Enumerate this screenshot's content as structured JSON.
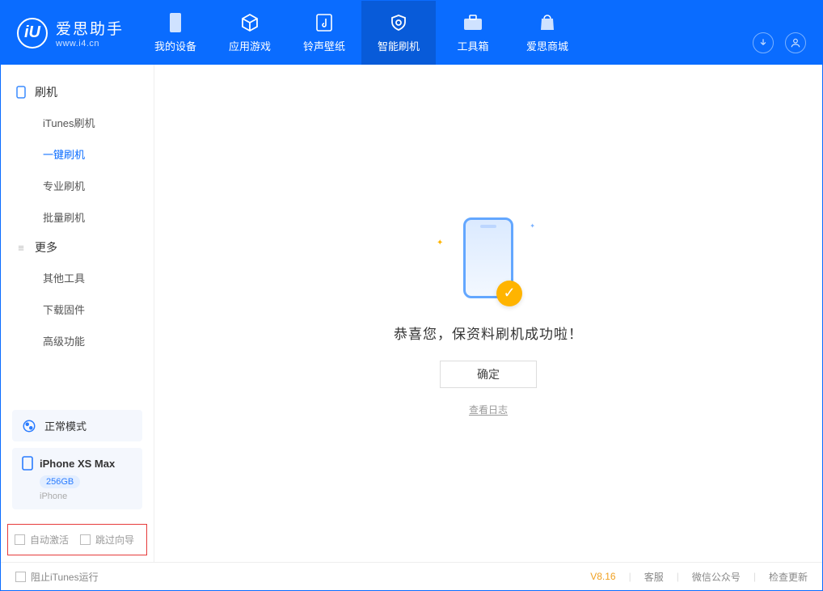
{
  "app": {
    "name": "爱思助手",
    "domain": "www.i4.cn"
  },
  "titlebar_icons": [
    "tshirt-icon",
    "cube-icon",
    "list-icon",
    "minimize-icon",
    "maximize-icon",
    "close-icon"
  ],
  "tabs": [
    {
      "id": "device",
      "label": "我的设备"
    },
    {
      "id": "apps",
      "label": "应用游戏"
    },
    {
      "id": "ring",
      "label": "铃声壁纸"
    },
    {
      "id": "flash",
      "label": "智能刷机",
      "active": true
    },
    {
      "id": "tools",
      "label": "工具箱"
    },
    {
      "id": "store",
      "label": "爱思商城"
    }
  ],
  "header_buttons": {
    "download": "download-icon",
    "user": "user-icon"
  },
  "sidebar": {
    "section1": {
      "title": "刷机",
      "items": [
        {
          "id": "itunes",
          "label": "iTunes刷机"
        },
        {
          "id": "onekey",
          "label": "一键刷机",
          "active": true
        },
        {
          "id": "pro",
          "label": "专业刷机"
        },
        {
          "id": "batch",
          "label": "批量刷机"
        }
      ]
    },
    "section2": {
      "title": "更多",
      "items": [
        {
          "id": "other",
          "label": "其他工具"
        },
        {
          "id": "fw",
          "label": "下载固件"
        },
        {
          "id": "adv",
          "label": "高级功能"
        }
      ]
    }
  },
  "mode": {
    "label": "正常模式"
  },
  "device": {
    "name": "iPhone XS Max",
    "capacity": "256GB",
    "type": "iPhone"
  },
  "options": {
    "auto_activate": "自动激活",
    "skip_guide": "跳过向导"
  },
  "main": {
    "success": "恭喜您，保资料刷机成功啦！",
    "ok": "确定",
    "view_log": "查看日志"
  },
  "footer": {
    "block_itunes": "阻止iTunes运行",
    "version": "V8.16",
    "links": [
      "客服",
      "微信公众号",
      "检查更新"
    ]
  }
}
